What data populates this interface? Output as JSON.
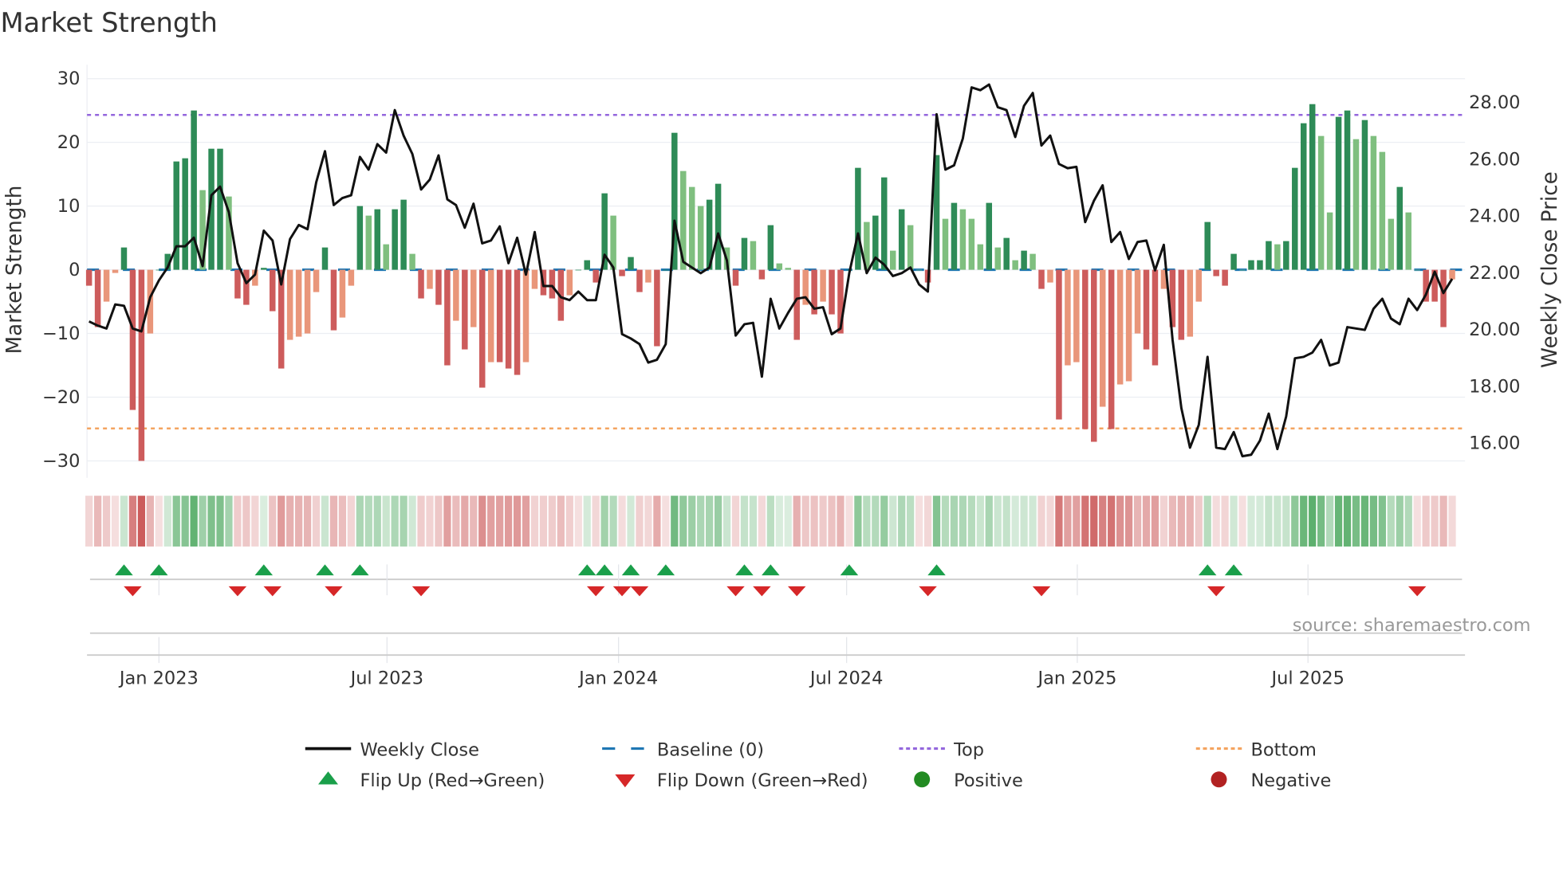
{
  "title": "Market Strength",
  "source": "source: sharemaestro.com",
  "chart_data": {
    "type": "bar",
    "title": "Market Strength",
    "ylabel": "Market Strength",
    "y2label": "Weekly Close Price",
    "ylim": [
      -32,
      32
    ],
    "y2lim": [
      15.3,
      28.8
    ],
    "yticks": [
      30,
      20,
      10,
      0,
      -10,
      -20,
      -30
    ],
    "yticklabels": [
      "30",
      "20",
      "10",
      "0",
      "−10",
      "−20",
      "−30"
    ],
    "y2ticks": [
      28,
      26,
      24,
      22,
      20,
      18,
      16
    ],
    "y2ticklabels": [
      "28.00",
      "26.00",
      "24.00",
      "22.00",
      "20.00",
      "18.00",
      "16.00"
    ],
    "xticks": [
      {
        "week": 8,
        "label": "Jan 2023"
      },
      {
        "week": 34.1,
        "label": "Jul 2023"
      },
      {
        "week": 60.6,
        "label": "Jan 2024"
      },
      {
        "week": 86.7,
        "label": "Jul 2024"
      },
      {
        "week": 113.1,
        "label": "Jan 2025"
      },
      {
        "week": 139.5,
        "label": "Jul 2025"
      }
    ],
    "top_level": 24.3,
    "bottom_level": -24.9,
    "baseline": 0,
    "strength": [
      -2.5,
      -9,
      -5,
      -0.5,
      3.5,
      -22,
      -30,
      -10,
      0,
      2.5,
      17,
      17.5,
      25,
      12.5,
      19,
      19,
      11.5,
      -4.5,
      -5.5,
      -2.5,
      0.3,
      -6.5,
      -15.5,
      -11,
      -10.5,
      -10,
      -3.5,
      3.5,
      -9.5,
      -7.5,
      -2.5,
      10,
      8.5,
      9.5,
      4,
      9.5,
      11,
      2.5,
      -4.5,
      -3,
      -5.5,
      -15,
      -8,
      -12.5,
      -9,
      -18.5,
      -14.5,
      -14.5,
      -15.5,
      -16.5,
      -14.5,
      -3,
      -4,
      -4.5,
      -8,
      -4,
      0,
      1.5,
      -2,
      12,
      8.5,
      -1,
      2,
      -3.5,
      -2,
      -12,
      0,
      21.5,
      15.5,
      13,
      10,
      11,
      13.5,
      3.5,
      -2.5,
      5,
      4.5,
      -1.5,
      7,
      1,
      0.3,
      -11,
      -5.5,
      -7,
      -5,
      -7,
      -10,
      0,
      16,
      7.5,
      8.5,
      14.5,
      3,
      9.5,
      7,
      0,
      -2,
      18,
      8,
      10.5,
      9.5,
      8,
      4,
      10.5,
      3.5,
      5,
      1.5,
      3,
      2.5,
      -3,
      -2,
      -23.5,
      -15,
      -14.5,
      -25,
      -27,
      -21.5,
      -25,
      -18,
      -17.5,
      -10,
      -12.5,
      -15,
      -3,
      -9,
      -11,
      -10.5,
      -5,
      7.5,
      -1,
      -2.5,
      2.5,
      0,
      1.5,
      1.5,
      4.5,
      4,
      4.5,
      16,
      23,
      26,
      21,
      9,
      24,
      25,
      20.5,
      23.5,
      21,
      18.5,
      8,
      13,
      9,
      0,
      -5,
      -5,
      -9,
      -1.5
    ],
    "weekly_close": [
      20.25,
      20.1,
      20.0,
      20.85,
      20.8,
      20.0,
      19.9,
      21.1,
      21.7,
      22.15,
      22.9,
      22.9,
      23.2,
      22.2,
      24.7,
      25.0,
      24.1,
      22.3,
      21.6,
      21.9,
      23.45,
      23.1,
      21.55,
      23.15,
      23.65,
      23.5,
      25.15,
      26.25,
      24.35,
      24.6,
      24.7,
      26.05,
      25.6,
      26.5,
      26.2,
      27.7,
      26.8,
      26.15,
      24.9,
      25.25,
      26.1,
      24.55,
      24.35,
      23.55,
      24.4,
      23.0,
      23.1,
      23.6,
      22.3,
      23.2,
      21.9,
      23.4,
      21.5,
      21.5,
      21.1,
      21.0,
      21.3,
      21.0,
      21.0,
      22.6,
      22.15,
      19.8,
      19.65,
      19.45,
      18.8,
      18.9,
      19.45,
      23.8,
      22.35,
      22.15,
      21.95,
      22.15,
      23.35,
      22.4,
      19.75,
      20.15,
      20.2,
      18.3,
      21.05,
      20.0,
      20.55,
      21.05,
      21.1,
      20.7,
      20.75,
      19.8,
      20.0,
      21.95,
      23.35,
      21.95,
      22.5,
      22.25,
      21.85,
      21.95,
      22.15,
      21.55,
      21.3,
      27.55,
      25.6,
      25.75,
      26.7,
      28.5,
      28.4,
      28.6,
      27.8,
      27.7,
      26.75,
      27.85,
      28.3,
      26.45,
      26.8,
      25.8,
      25.65,
      25.7,
      23.75,
      24.5,
      25.05,
      23.05,
      23.4,
      22.45,
      23.05,
      23.1,
      22.05,
      22.95,
      19.6,
      17.2,
      15.8,
      16.6,
      19.0,
      15.8,
      15.75,
      16.35,
      15.5,
      15.55,
      16.05,
      17.0,
      15.75,
      16.9,
      18.95,
      19.0,
      19.15,
      19.6,
      18.7,
      18.8,
      20.05,
      20.0,
      19.95,
      20.7,
      21.05,
      20.35,
      20.15,
      21.05,
      20.65,
      21.2,
      22.0,
      21.25,
      21.75
    ],
    "flip_up_weeks": [
      4,
      8,
      20,
      27,
      31,
      57,
      59,
      62,
      66,
      75,
      78,
      87,
      97,
      128,
      131
    ],
    "flip_down_weeks": [
      5,
      17,
      21,
      28,
      38,
      58,
      61,
      63,
      74,
      77,
      81,
      96,
      109,
      129,
      152
    ],
    "colors": {
      "strong_up": "#2e8b57",
      "weak_up": "#7fbf7f",
      "strong_down": "#cd5c5c",
      "weak_down": "#e9967a",
      "line": "#111111",
      "baseline": "#1f77b4",
      "top": "#9467dd",
      "bottom": "#f4a460",
      "flip_up": "#1a9f4a",
      "flip_down": "#d62728",
      "positive": "#228b22",
      "negative": "#b22222"
    },
    "legend": {
      "position": "bottom",
      "items": [
        {
          "key": "close",
          "label": "Weekly Close"
        },
        {
          "key": "baseline",
          "label": "Baseline (0)"
        },
        {
          "key": "top",
          "label": "Top"
        },
        {
          "key": "bottom",
          "label": "Bottom"
        },
        {
          "key": "flip_up",
          "label": "Flip Up (Red→Green)"
        },
        {
          "key": "flip_down",
          "label": "Flip Down (Green→Red)"
        },
        {
          "key": "positive",
          "label": "Positive"
        },
        {
          "key": "negative",
          "label": "Negative"
        }
      ]
    }
  }
}
